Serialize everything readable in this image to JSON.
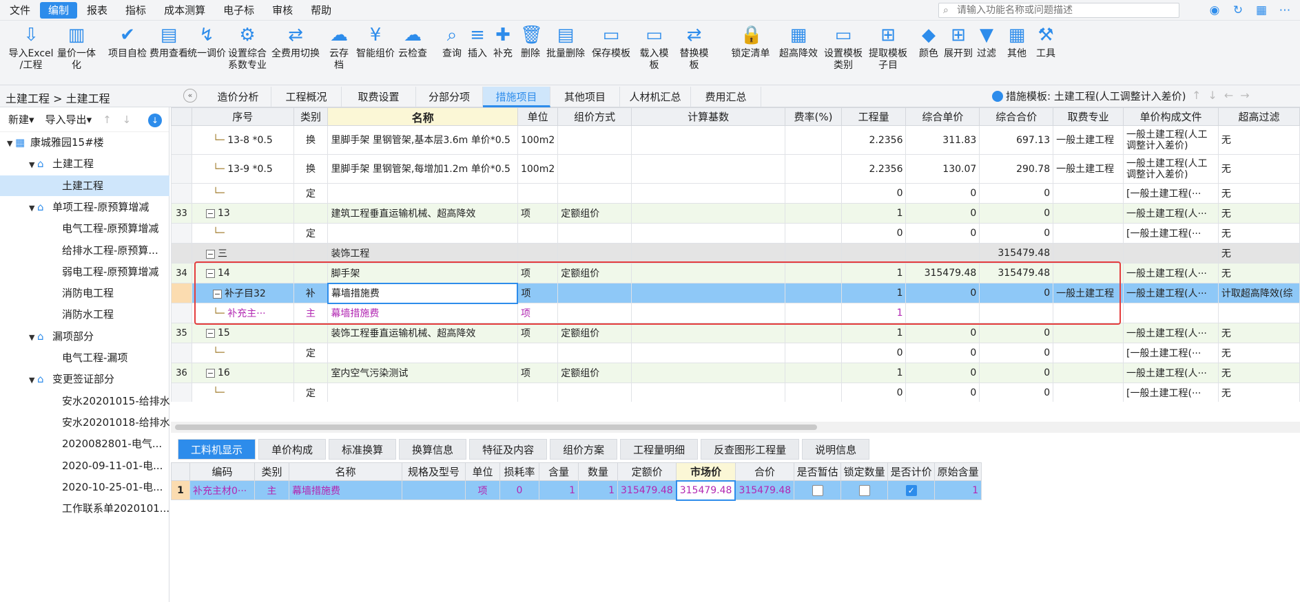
{
  "menubar": {
    "items": [
      "文件",
      "编制",
      "报表",
      "指标",
      "成本测算",
      "电子标",
      "审核",
      "帮助"
    ],
    "active": "编制",
    "search_placeholder": "请输入功能名称或问题描述"
  },
  "toolbar": {
    "buttons": [
      {
        "l1": "导入Excel",
        "l2": "/工程",
        "icon": "import-excel-icon"
      },
      {
        "l1": "量价一体化",
        "l2": "",
        "icon": "quantity-price-icon"
      },
      {
        "l1": "项目自检",
        "l2": "",
        "icon": "self-check-icon"
      },
      {
        "l1": "费用查看",
        "l2": "",
        "icon": "fee-view-icon"
      },
      {
        "l1": "统一调价",
        "l2": "",
        "icon": "unified-price-icon"
      },
      {
        "l1": "设置综合",
        "l2": "系数专业",
        "icon": "set-coefficient-icon"
      },
      {
        "l1": "全费用切换",
        "l2": "",
        "icon": "full-cost-switch-icon"
      },
      {
        "l1": "云存档",
        "l2": "",
        "icon": "cloud-archive-icon"
      },
      {
        "l1": "智能组价",
        "l2": "",
        "icon": "smart-pricing-icon"
      },
      {
        "l1": "云检查",
        "l2": "",
        "icon": "cloud-check-icon"
      },
      {
        "l1": "查询",
        "l2": "",
        "icon": "query-icon"
      },
      {
        "l1": "插入",
        "l2": "",
        "icon": "insert-icon"
      },
      {
        "l1": "补充",
        "l2": "",
        "icon": "supplement-icon"
      },
      {
        "l1": "删除",
        "l2": "",
        "icon": "delete-icon"
      },
      {
        "l1": "批量删除",
        "l2": "",
        "icon": "batch-delete-icon"
      },
      {
        "l1": "保存模板",
        "l2": "",
        "icon": "save-template-icon"
      },
      {
        "l1": "载入模板",
        "l2": "",
        "icon": "load-template-icon"
      },
      {
        "l1": "替换模板",
        "l2": "",
        "icon": "replace-template-icon"
      },
      {
        "l1": "锁定清单",
        "l2": "",
        "icon": "lock-list-icon"
      },
      {
        "l1": "超高降效",
        "l2": "",
        "icon": "super-height-icon"
      },
      {
        "l1": "设置模板",
        "l2": "类别",
        "icon": "set-template-icon"
      },
      {
        "l1": "提取模板",
        "l2": "子目",
        "icon": "extract-template-icon"
      },
      {
        "l1": "颜色",
        "l2": "",
        "icon": "color-icon"
      },
      {
        "l1": "展开到",
        "l2": "",
        "icon": "expand-to-icon"
      },
      {
        "l1": "过滤",
        "l2": "",
        "icon": "filter-icon"
      },
      {
        "l1": "其他",
        "l2": "",
        "icon": "other-icon"
      },
      {
        "l1": "工具",
        "l2": "",
        "icon": "tools-icon"
      }
    ]
  },
  "breadcrumb": "土建工程 > 土建工程",
  "page_tabs": [
    "造价分析",
    "工程概况",
    "取费设置",
    "分部分项",
    "措施项目",
    "其他项目",
    "人材机汇总",
    "费用汇总"
  ],
  "active_page_tab": "措施项目",
  "measure_template": "措施模板: 土建工程(人工调整计入差价)",
  "sidebar": {
    "new_label": "新建",
    "import_export_label": "导入导出",
    "tree": [
      {
        "label": "康城雅园15#楼",
        "level": 0,
        "arrow": "▼",
        "icon": "building-icon"
      },
      {
        "label": "土建工程",
        "level": 1,
        "arrow": "▼",
        "icon": "home-icon"
      },
      {
        "label": "土建工程",
        "level": 2,
        "selected": true
      },
      {
        "label": "单项工程-原预算增减",
        "level": 1,
        "arrow": "▼",
        "icon": "home-icon"
      },
      {
        "label": "电气工程-原预算增减",
        "level": 2
      },
      {
        "label": "给排水工程-原预算...",
        "level": 2
      },
      {
        "label": "弱电工程-原预算增减",
        "level": 2
      },
      {
        "label": "消防电工程",
        "level": 2
      },
      {
        "label": "消防水工程",
        "level": 2
      },
      {
        "label": "漏项部分",
        "level": 1,
        "arrow": "▼",
        "icon": "home-icon"
      },
      {
        "label": "电气工程-漏项",
        "level": 2
      },
      {
        "label": "变更签证部分",
        "level": 1,
        "arrow": "▼",
        "icon": "home-icon"
      },
      {
        "label": "安水20201015-给排水",
        "level": 2
      },
      {
        "label": "安水20201018-给排水",
        "level": 2
      },
      {
        "label": "2020082801-电气...",
        "level": 2
      },
      {
        "label": "2020-09-11-01-电...",
        "level": 2
      },
      {
        "label": "2020-10-25-01-电...",
        "level": 2
      },
      {
        "label": "工作联系单2020101...",
        "level": 2
      }
    ]
  },
  "main_table": {
    "headers": [
      "序号",
      "类别",
      "名称",
      "单位",
      "组价方式",
      "计算基数",
      "费率(%)",
      "工程量",
      "综合单价",
      "综合合价",
      "取费专业",
      "单价构成文件",
      "超高过滤"
    ],
    "rows": [
      {
        "rn": "",
        "seq": "13-8 *0.5",
        "cat": "换",
        "name": "里脚手架 里钢管架,基本层3.6m 单价*0.5",
        "unit": "100m2",
        "method": "",
        "base": "",
        "rate": "",
        "qty": "2.2356",
        "uprice": "311.83",
        "total": "697.13",
        "fee": "一般土建工程",
        "file": "一般土建工程(人工调整计入差价)",
        "sup": "无",
        "style": "r2",
        "tree": "└─"
      },
      {
        "rn": "",
        "seq": "13-9 *0.5",
        "cat": "换",
        "name": "里脚手架 里钢管架,每增加1.2m 单价*0.5",
        "unit": "100m2",
        "method": "",
        "base": "",
        "rate": "",
        "qty": "2.2356",
        "uprice": "130.07",
        "total": "290.78",
        "fee": "一般土建工程",
        "file": "一般土建工程(人工调整计入差价)",
        "sup": "无",
        "style": "r2",
        "tree": "└─"
      },
      {
        "rn": "",
        "seq": "",
        "cat": "定",
        "name": "",
        "unit": "",
        "method": "",
        "base": "",
        "rate": "",
        "qty": "0",
        "uprice": "0",
        "total": "0",
        "fee": "",
        "file": "[一般土建工程(···",
        "sup": "无",
        "style": "",
        "tree": "└─"
      },
      {
        "rn": "33",
        "seq": "13",
        "cat": "",
        "name": "建筑工程垂直运输机械、超高降效",
        "unit": "项",
        "method": "定额组价",
        "base": "",
        "rate": "",
        "qty": "1",
        "uprice": "0",
        "total": "0",
        "fee": "",
        "file": "一般土建工程(人···",
        "sup": "无",
        "style": "green",
        "tree": "",
        "box": "−"
      },
      {
        "rn": "",
        "seq": "",
        "cat": "定",
        "name": "",
        "unit": "",
        "method": "",
        "base": "",
        "rate": "",
        "qty": "0",
        "uprice": "0",
        "total": "0",
        "fee": "",
        "file": "[一般土建工程(···",
        "sup": "无",
        "style": "",
        "tree": "└─"
      },
      {
        "rn": "",
        "seq": "三",
        "cat": "",
        "name": "装饰工程",
        "unit": "",
        "method": "",
        "base": "",
        "rate": "",
        "qty": "",
        "uprice": "",
        "total": "315479.48",
        "fee": "",
        "file": "",
        "sup": "无",
        "style": "gray",
        "tree": "",
        "box": "−"
      },
      {
        "rn": "34",
        "seq": "14",
        "cat": "",
        "name": "脚手架",
        "unit": "项",
        "method": "定额组价",
        "base": "",
        "rate": "",
        "qty": "1",
        "uprice": "315479.48",
        "total": "315479.48",
        "fee": "",
        "file": "一般土建工程(人···",
        "sup": "无",
        "style": "green",
        "tree": "",
        "box": "−"
      },
      {
        "rn": "",
        "seq": "补子目32",
        "cat": "补",
        "name": "幕墙措施费",
        "unit": "项",
        "method": "",
        "base": "",
        "rate": "",
        "qty": "1",
        "uprice": "0",
        "total": "0",
        "fee": "一般土建工程",
        "file": "一般土建工程(人···",
        "sup": "计取超高降效(综",
        "style": "sel",
        "tree": "",
        "box": "−"
      },
      {
        "rn": "",
        "seq": "补充主···",
        "cat": "主",
        "name": "幕墙措施费",
        "unit": "项",
        "method": "",
        "base": "",
        "rate": "",
        "qty": "1",
        "uprice": "",
        "total": "",
        "fee": "",
        "file": "",
        "sup": "",
        "style": "purple",
        "tree": "└─"
      },
      {
        "rn": "35",
        "seq": "15",
        "cat": "",
        "name": "装饰工程垂直运输机械、超高降效",
        "unit": "项",
        "method": "定额组价",
        "base": "",
        "rate": "",
        "qty": "1",
        "uprice": "0",
        "total": "0",
        "fee": "",
        "file": "一般土建工程(人···",
        "sup": "无",
        "style": "green",
        "tree": "",
        "box": "−"
      },
      {
        "rn": "",
        "seq": "",
        "cat": "定",
        "name": "",
        "unit": "",
        "method": "",
        "base": "",
        "rate": "",
        "qty": "0",
        "uprice": "0",
        "total": "0",
        "fee": "",
        "file": "[一般土建工程(···",
        "sup": "无",
        "style": "",
        "tree": "└─"
      },
      {
        "rn": "36",
        "seq": "16",
        "cat": "",
        "name": "室内空气污染测试",
        "unit": "项",
        "method": "定额组价",
        "base": "",
        "rate": "",
        "qty": "1",
        "uprice": "0",
        "total": "0",
        "fee": "",
        "file": "一般土建工程(人···",
        "sup": "无",
        "style": "green",
        "tree": "",
        "box": "−"
      },
      {
        "rn": "",
        "seq": "",
        "cat": "定",
        "name": "",
        "unit": "",
        "method": "",
        "base": "",
        "rate": "",
        "qty": "0",
        "uprice": "0",
        "total": "0",
        "fee": "",
        "file": "[一般土建工程(···",
        "sup": "无",
        "style": "",
        "tree": "└─"
      }
    ]
  },
  "bottom_tabs": [
    "工料机显示",
    "单价构成",
    "标准换算",
    "换算信息",
    "特征及内容",
    "组价方案",
    "工程量明细",
    "反查图形工程量",
    "说明信息"
  ],
  "active_bottom_tab": "工料机显示",
  "bottom_table": {
    "headers": [
      "编码",
      "类别",
      "名称",
      "规格及型号",
      "单位",
      "损耗率",
      "含量",
      "数量",
      "定额价",
      "市场价",
      "合价",
      "是否暂估",
      "锁定数量",
      "是否计价",
      "原始含量"
    ],
    "rows": [
      {
        "rn": "1",
        "code": "补充主材0···",
        "cat": "主",
        "name": "幕墙措施费",
        "spec": "",
        "unit": "项",
        "loss": "0",
        "content": "1",
        "qty": "1",
        "quota": "315479.48",
        "market": "315479.48",
        "total": "315479.48",
        "est": false,
        "lock": false,
        "priced": true,
        "orig": "1"
      }
    ]
  },
  "colors": {
    "accent": "#2d8ceb",
    "selected_row": "#8ec8f7",
    "highlight_box": "#e43c3c",
    "supplement_text": "#b227b2"
  }
}
